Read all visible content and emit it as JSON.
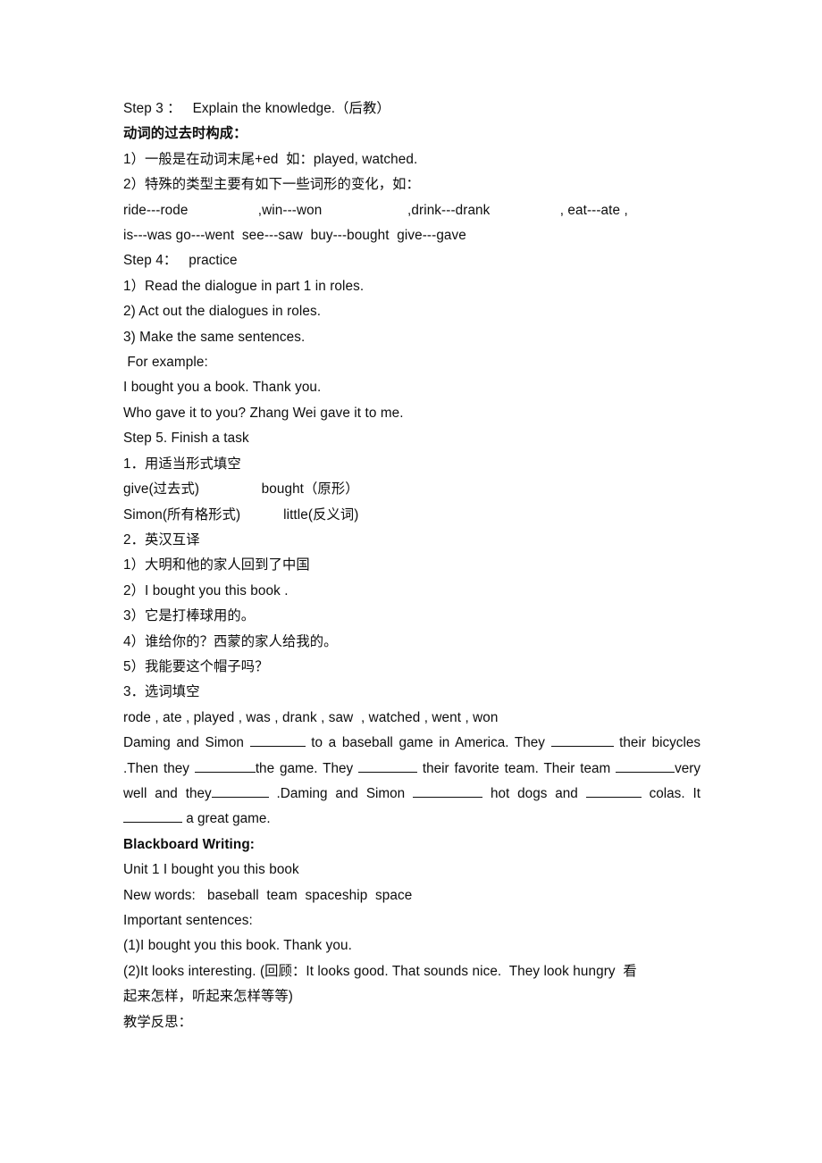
{
  "document": {
    "lines": {
      "step3_heading": "Step 3 ：   Explain the knowledge.（后教）",
      "past_tense_title": "动词的过去时构成：",
      "rule1": "1）一般是在动词末尾+ed  如：played, watched.",
      "rule2": "2）特殊的类型主要有如下一些词形的变化，如：",
      "verbs_line1": "ride---rode                  ,win---won                      ,drink---drank                  , eat---ate ,",
      "verbs_line2": "is---was go---went  see---saw  buy---bought  give---gave",
      "step4_heading": "Step 4：   practice",
      "step4_item1": "1）Read the dialogue in part 1 in roles.",
      "step4_item2": "2) Act out the dialogues in roles.",
      "step4_item3": "3) Make the same sentences.",
      "for_example": " For example:",
      "example1": "I bought you a book. Thank you.",
      "example2": "Who gave it to you? Zhang Wei gave it to me.",
      "step5_heading": "Step 5. Finish a task",
      "task1_heading": "1．用适当形式填空",
      "task1_row1": "give(过去式)                bought（原形）",
      "task1_row2": "Simon(所有格形式)           little(反义词)",
      "task2_heading": "2．英汉互译",
      "task2_item1": "1）大明和他的家人回到了中国",
      "task2_item2": "2）I bought you this book .",
      "task2_item3": "3）它是打棒球用的。",
      "task2_item4": "4）谁给你的？西蒙的家人给我的。",
      "task2_item5": "5）我能要这个帽子吗？",
      "task3_heading": "3．选词填空",
      "task3_wordbank": "rode , ate , played , was , drank , saw  , watched , went , won",
      "blackboard_heading": "Blackboard Writing:",
      "bb_unit": "Unit 1 I bought you this book",
      "bb_newwords": "New words:   baseball  team  spaceship  space",
      "bb_important": "Important sentences:",
      "bb_sentence1": "(1)I bought you this book. Thank you.",
      "reflection": "教学反思："
    },
    "cloze_paragraph": {
      "seg1": "Daming and Simon ",
      "seg2": " to a baseball game in America. They ",
      "seg3": " their bicycles .Then they ",
      "seg4": "the game. They ",
      "seg5": " their favorite team. Their team ",
      "seg6": "very well and they",
      "seg7": " .Daming and Simon ",
      "seg8": " hot dogs and ",
      "seg9": " colas. It ",
      "seg10": " a great game."
    },
    "bb_sentence2": {
      "part1": "(2)It looks interesting. (回顾：It looks good. That sounds nice.  They look hungry  看",
      "part2": "起来怎样，听起来怎样等等)"
    }
  }
}
